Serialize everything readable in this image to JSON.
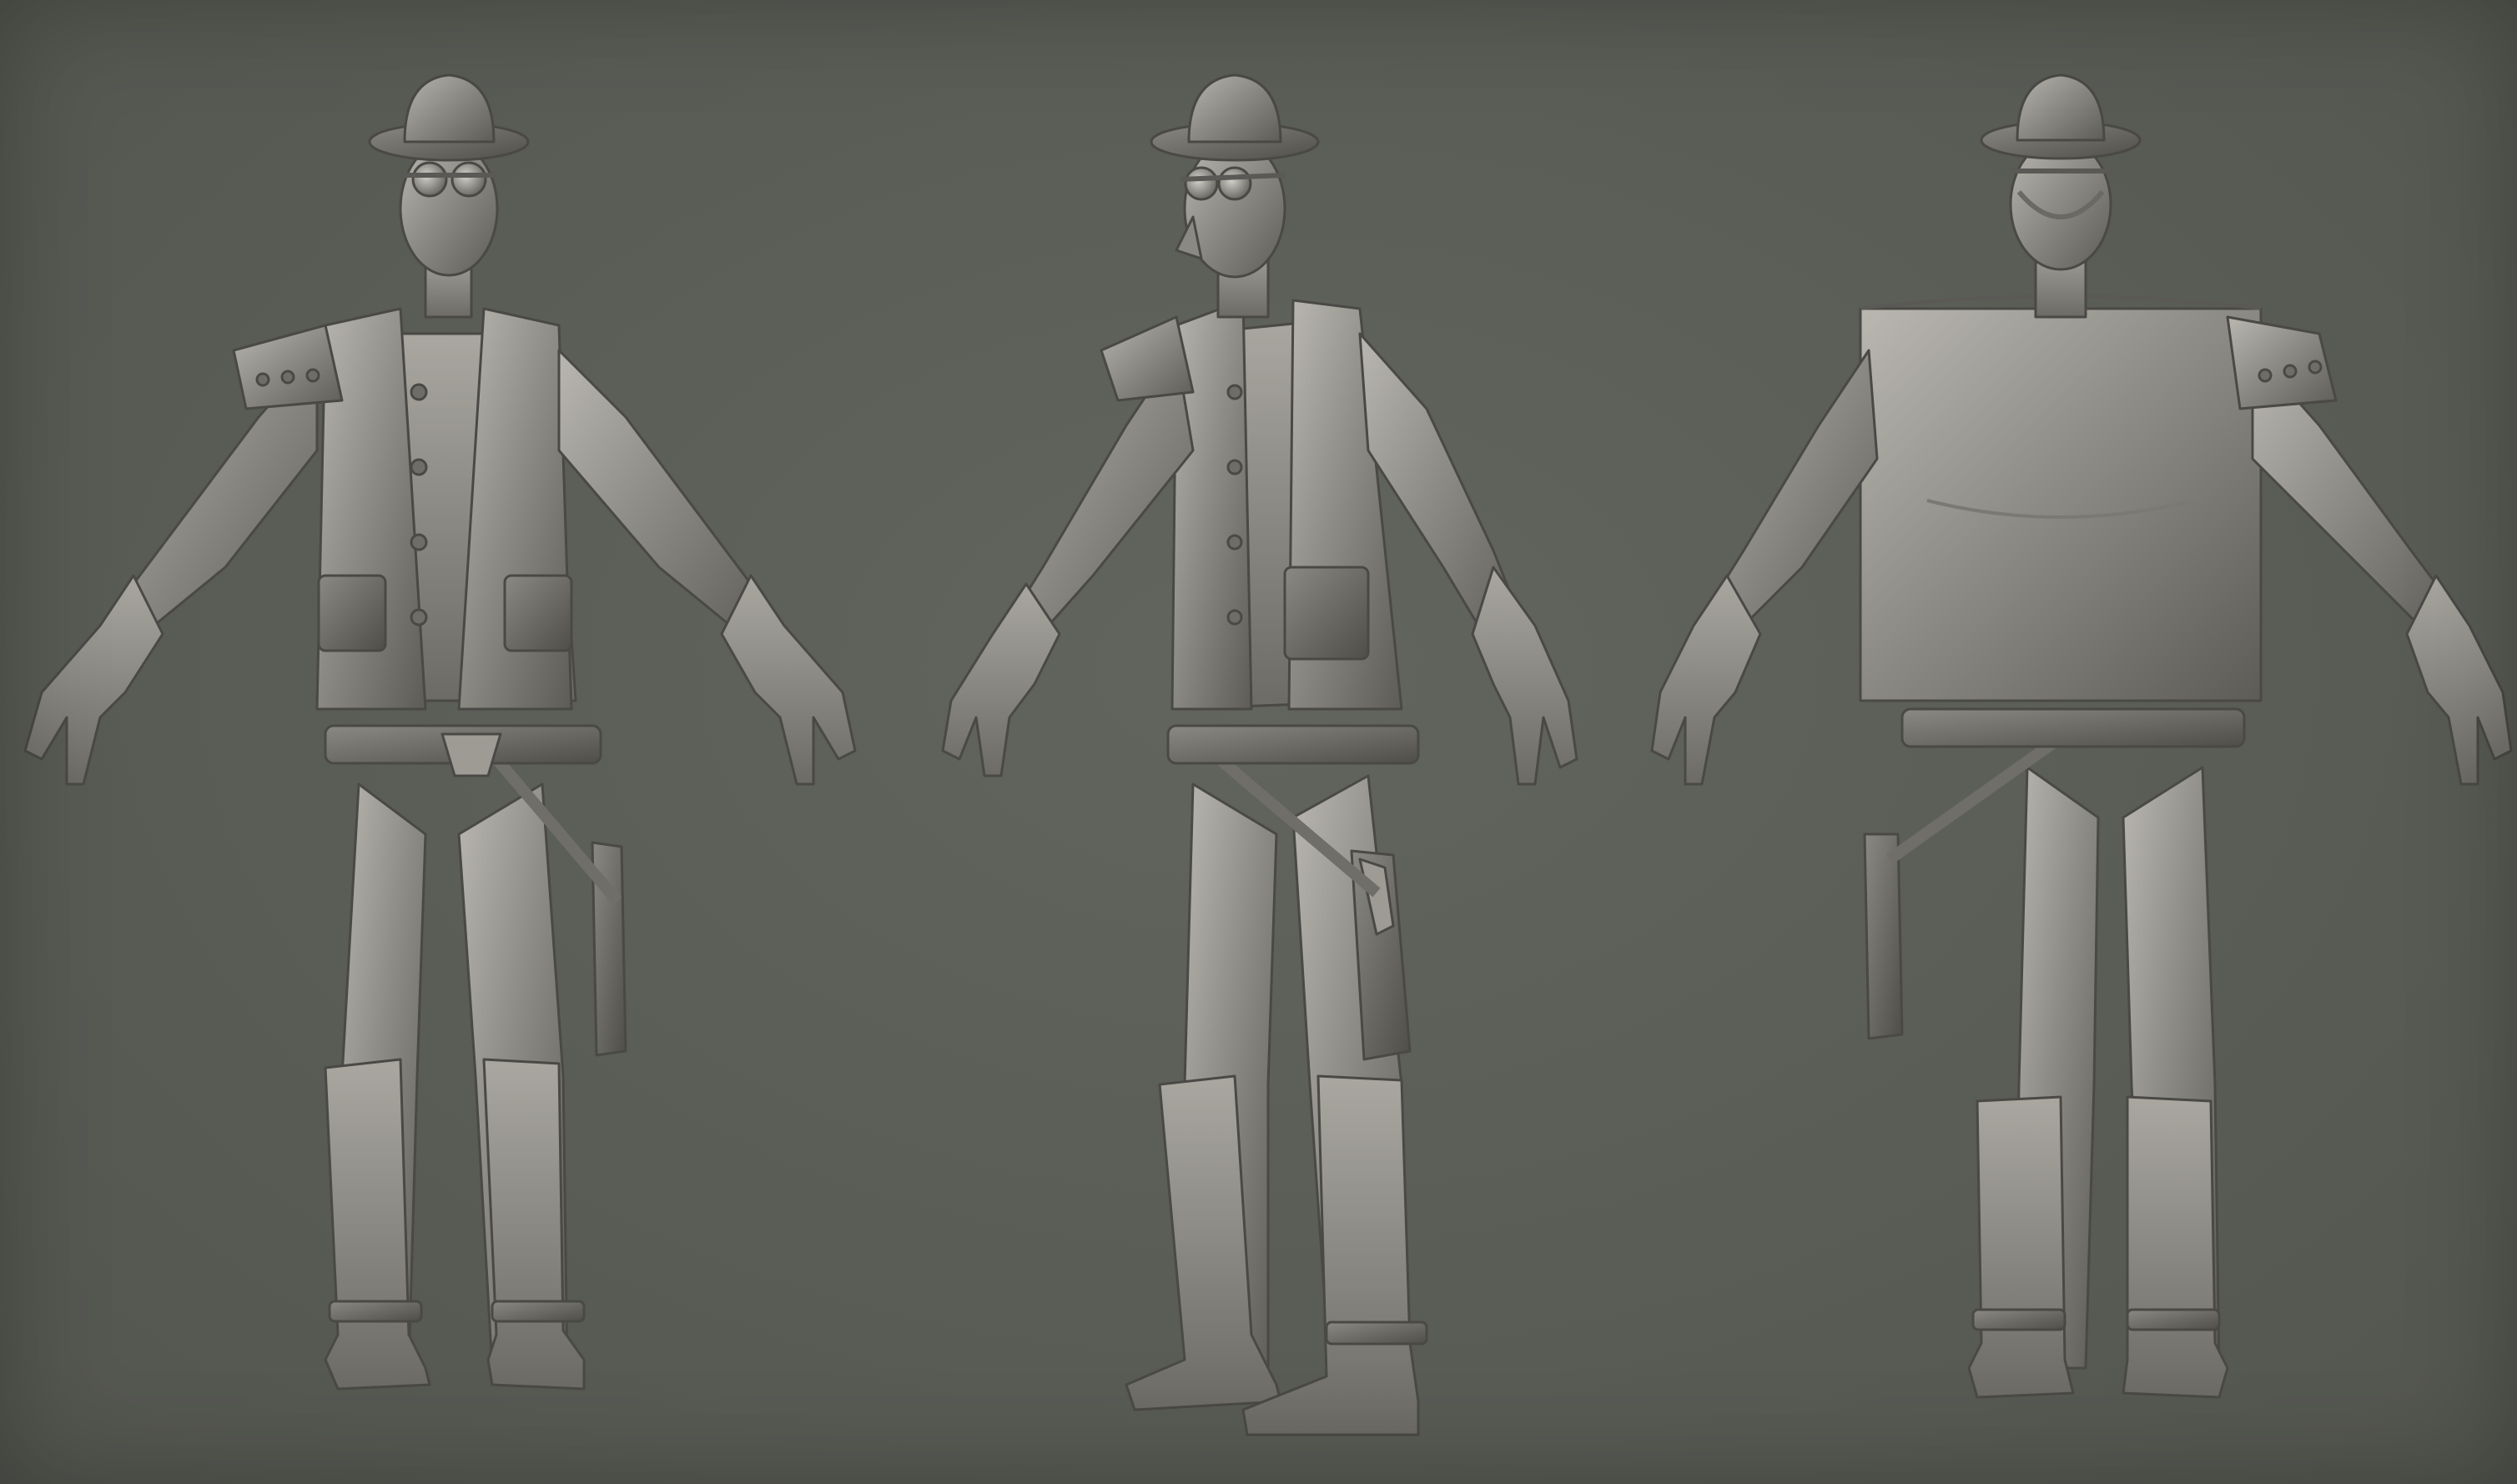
{
  "scene": {
    "background_color": "#5a5c56",
    "clay_color": "#8c8b85",
    "clay_highlight": "#b3b1aa",
    "clay_shadow": "#5f5e59",
    "views": [
      {
        "id": "front",
        "icon": "character-front-view"
      },
      {
        "id": "three-quarter",
        "icon": "character-three-quarter-view"
      },
      {
        "id": "back",
        "icon": "character-back-view"
      }
    ]
  }
}
